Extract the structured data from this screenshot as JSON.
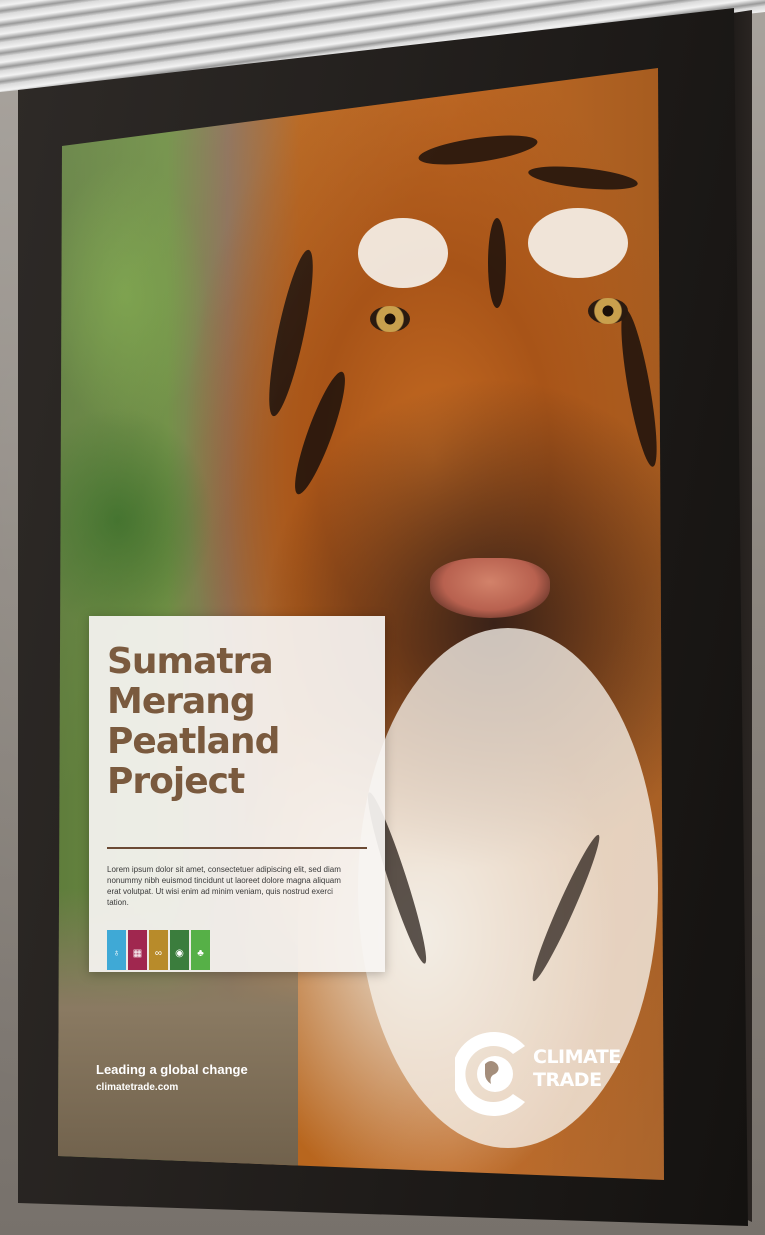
{
  "poster": {
    "title_lines": [
      "Sumatra",
      "Merang",
      "Peatland",
      "Project"
    ],
    "body": "Lorem ipsum dolor sit amet, consectetuer adipiscing elit, sed diam nonummy nibh euismod tincidunt ut laoreet dolore magna aliquam erat volutpat. Ut wisi enim ad minim veniam, quis nostrud exerci tation.",
    "sdg_icons": [
      {
        "icon": "water-drop-icon",
        "color": "#3fa9d6",
        "glyph": "♁"
      },
      {
        "icon": "industry-icon",
        "color": "#a0274f",
        "glyph": "▦"
      },
      {
        "icon": "infinity-icon",
        "color": "#b88b2a",
        "glyph": "∞"
      },
      {
        "icon": "eye-icon",
        "color": "#3b7d3d",
        "glyph": "◉"
      },
      {
        "icon": "tree-icon",
        "color": "#56b047",
        "glyph": "♣"
      }
    ],
    "tagline": "Leading a global change",
    "url": "climatetrade.com",
    "logo_lines": [
      "CLIMATE",
      "TRADE"
    ]
  },
  "colors": {
    "title": "#7a5a3e",
    "frame": "#1c1917",
    "panel": "#f7f5f3"
  }
}
